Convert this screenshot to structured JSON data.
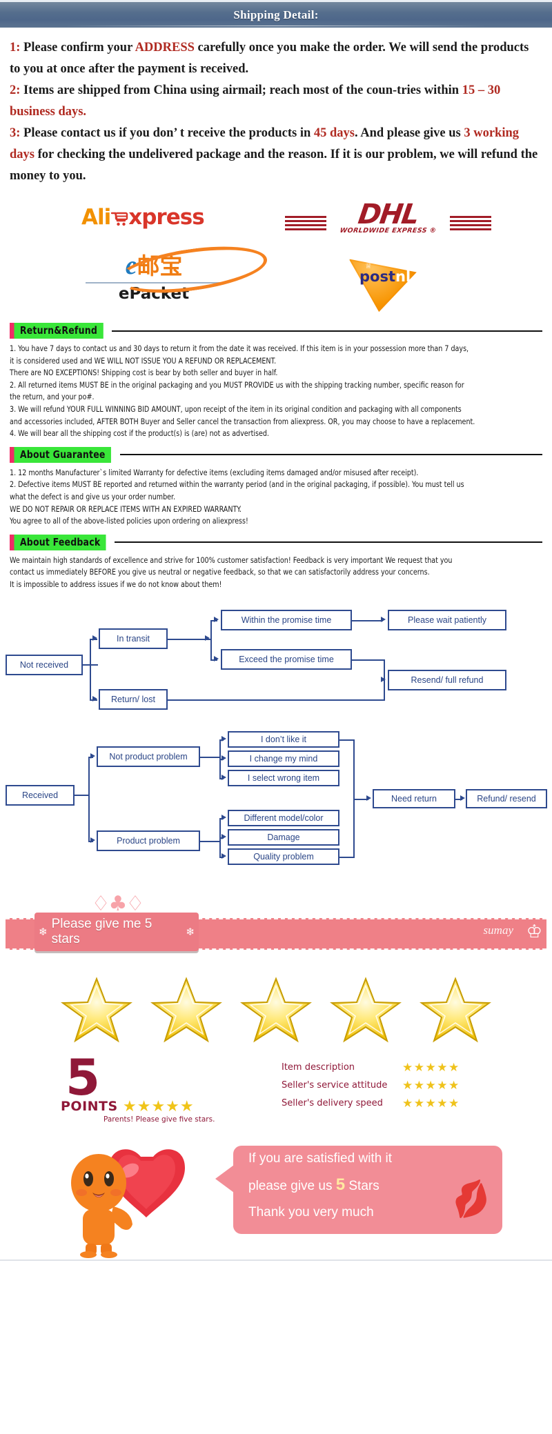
{
  "header": {
    "title": "Shipping Detail:"
  },
  "shipping": {
    "items": [
      {
        "num": "1:",
        "parts": [
          {
            "t": "Please confirm your ",
            "hl": false
          },
          {
            "t": "ADDRESS",
            "hl": true
          },
          {
            "t": " carefully once you make the order. We will send the products to you at once after the payment is received.",
            "hl": false
          }
        ]
      },
      {
        "num": "2:",
        "parts": [
          {
            "t": "Items are shipped from China using airmail; reach most of the coun-tries within ",
            "hl": false
          },
          {
            "t": "15 – 30 business days.",
            "hl": true
          }
        ]
      },
      {
        "num": "3:",
        "parts": [
          {
            "t": "Please contact us if you don’ t receive the products in ",
            "hl": false
          },
          {
            "t": "45 days",
            "hl": true
          },
          {
            "t": ". And please give us ",
            "hl": false
          },
          {
            "t": "3 working days",
            "hl": true
          },
          {
            "t": " for checking the undelivered package and the reason. If it is our problem, we will refund the money to you.",
            "hl": false
          }
        ]
      }
    ]
  },
  "logos": {
    "aliexpress": {
      "ali": "Ali",
      "xpress": "xpress",
      "cart_icon": "shopping-cart-icon"
    },
    "dhl": {
      "word": "DHL",
      "sub": "WORLDWIDE EXPRESS ®"
    },
    "epacket": {
      "cn_e": "e",
      "cn": "邮宝",
      "name": "ePacket"
    },
    "postnl": {
      "post": "post",
      "nl": "nl",
      "crown": "♕"
    }
  },
  "sections": [
    {
      "tag": "Return&Refund",
      "lines": [
        "1. You have 7 days to contact us and 30 days to return it from the date it was received. If this item is in your possession more than 7 days,",
        "it is considered used and WE WILL NOT ISSUE YOU A REFUND OR REPLACEMENT.",
        "There are NO EXCEPTIONS! Shipping cost is bear by both seller and buyer in half.",
        "2. All returned items MUST BE in the original packaging and you MUST PROVIDE us with the shipping tracking number, specific reason for",
        "the return, and your po#.",
        "3. We will refund YOUR FULL WINNING BID AMOUNT, upon receipt of the item in its original condition and packaging with all components",
        "and accessories included, AFTER BOTH Buyer and Seller cancel the transaction from aliexpress. OR, you may choose to have a replacement.",
        "4.  We will bear all the shipping cost if the product(s) is (are) not as advertised."
      ]
    },
    {
      "tag": "About Guarantee",
      "lines": [
        "1. 12 months Manufacturer`s limited Warranty for defective items (excluding items damaged and/or misused after receipt).",
        "2. Defective items MUST BE reported and returned within the warranty period (and in the original packaging, if possible). You must tell us",
        "what the defect is and give us your order number.",
        "WE DO NOT REPAIR OR REPLACE ITEMS WITH AN EXPIRED WARRANTY.",
        "You agree to all of the above-listed policies upon ordering on aliexpress!"
      ]
    },
    {
      "tag": "About Feedback",
      "lines": [
        "We maintain high standards of excellence and strive for 100% customer satisfaction! Feedback is very important We request that you",
        "contact us immediately BEFORE you give us neutral or negative feedback, so that we can satisfactorily address your concerns.",
        "It is impossible to address issues if we do not know about them!"
      ]
    }
  ],
  "flow_not_received": {
    "nodes": {
      "root": "Not received",
      "in_transit": "In transit",
      "return_lost": "Return/ lost",
      "within": "Within the promise time",
      "exceed": "Exceed the promise time",
      "wait": "Please wait patiently",
      "resend": "Resend/ full refund"
    }
  },
  "flow_received": {
    "nodes": {
      "root": "Received",
      "not_product": "Not product problem",
      "product": "Product problem",
      "dislike": "I don’t like it",
      "change_mind": "I change my mind",
      "wrong_item": "I select wrong item",
      "diff_model": "Different model/color",
      "damage": "Damage",
      "quality": "Quality problem",
      "need_return": "Need return",
      "refund_resend": "Refund/ resend"
    }
  },
  "banner": {
    "text": "Please give me 5 stars",
    "brand": "sumay",
    "crown_icon": "crown-icon",
    "bow_icon": "bow-icon"
  },
  "stars": {
    "count": 5,
    "star_icon": "star-icon"
  },
  "points": {
    "big_number": "5",
    "label": "POINTS",
    "stars": "★★★★★",
    "note": "Parents! Please give five stars.",
    "ratings": [
      {
        "label": "Item description",
        "stars": "★★★★★"
      },
      {
        "label": "Seller's service attitude",
        "stars": "★★★★★"
      },
      {
        "label": "Seller's delivery speed",
        "stars": "★★★★★"
      }
    ]
  },
  "closing": {
    "line1": "If you are satisfied with it",
    "line2_a": "please give us ",
    "line2_b": "5",
    "line2_c": " Stars",
    "line3": "Thank you very much",
    "bear_icon": "bear-mascot-icon",
    "heart_icon": "heart-icon",
    "kiss_icon": "lips-kiss-icon"
  },
  "colors": {
    "header_bg": "#50688a",
    "accent_red": "#b02a21",
    "tag_green": "#39e639",
    "tag_pink": "#ef2d66",
    "flow_blue": "#2e4a8f",
    "banner_pink": "#ef8087",
    "star_yellow": "#f5d033"
  }
}
